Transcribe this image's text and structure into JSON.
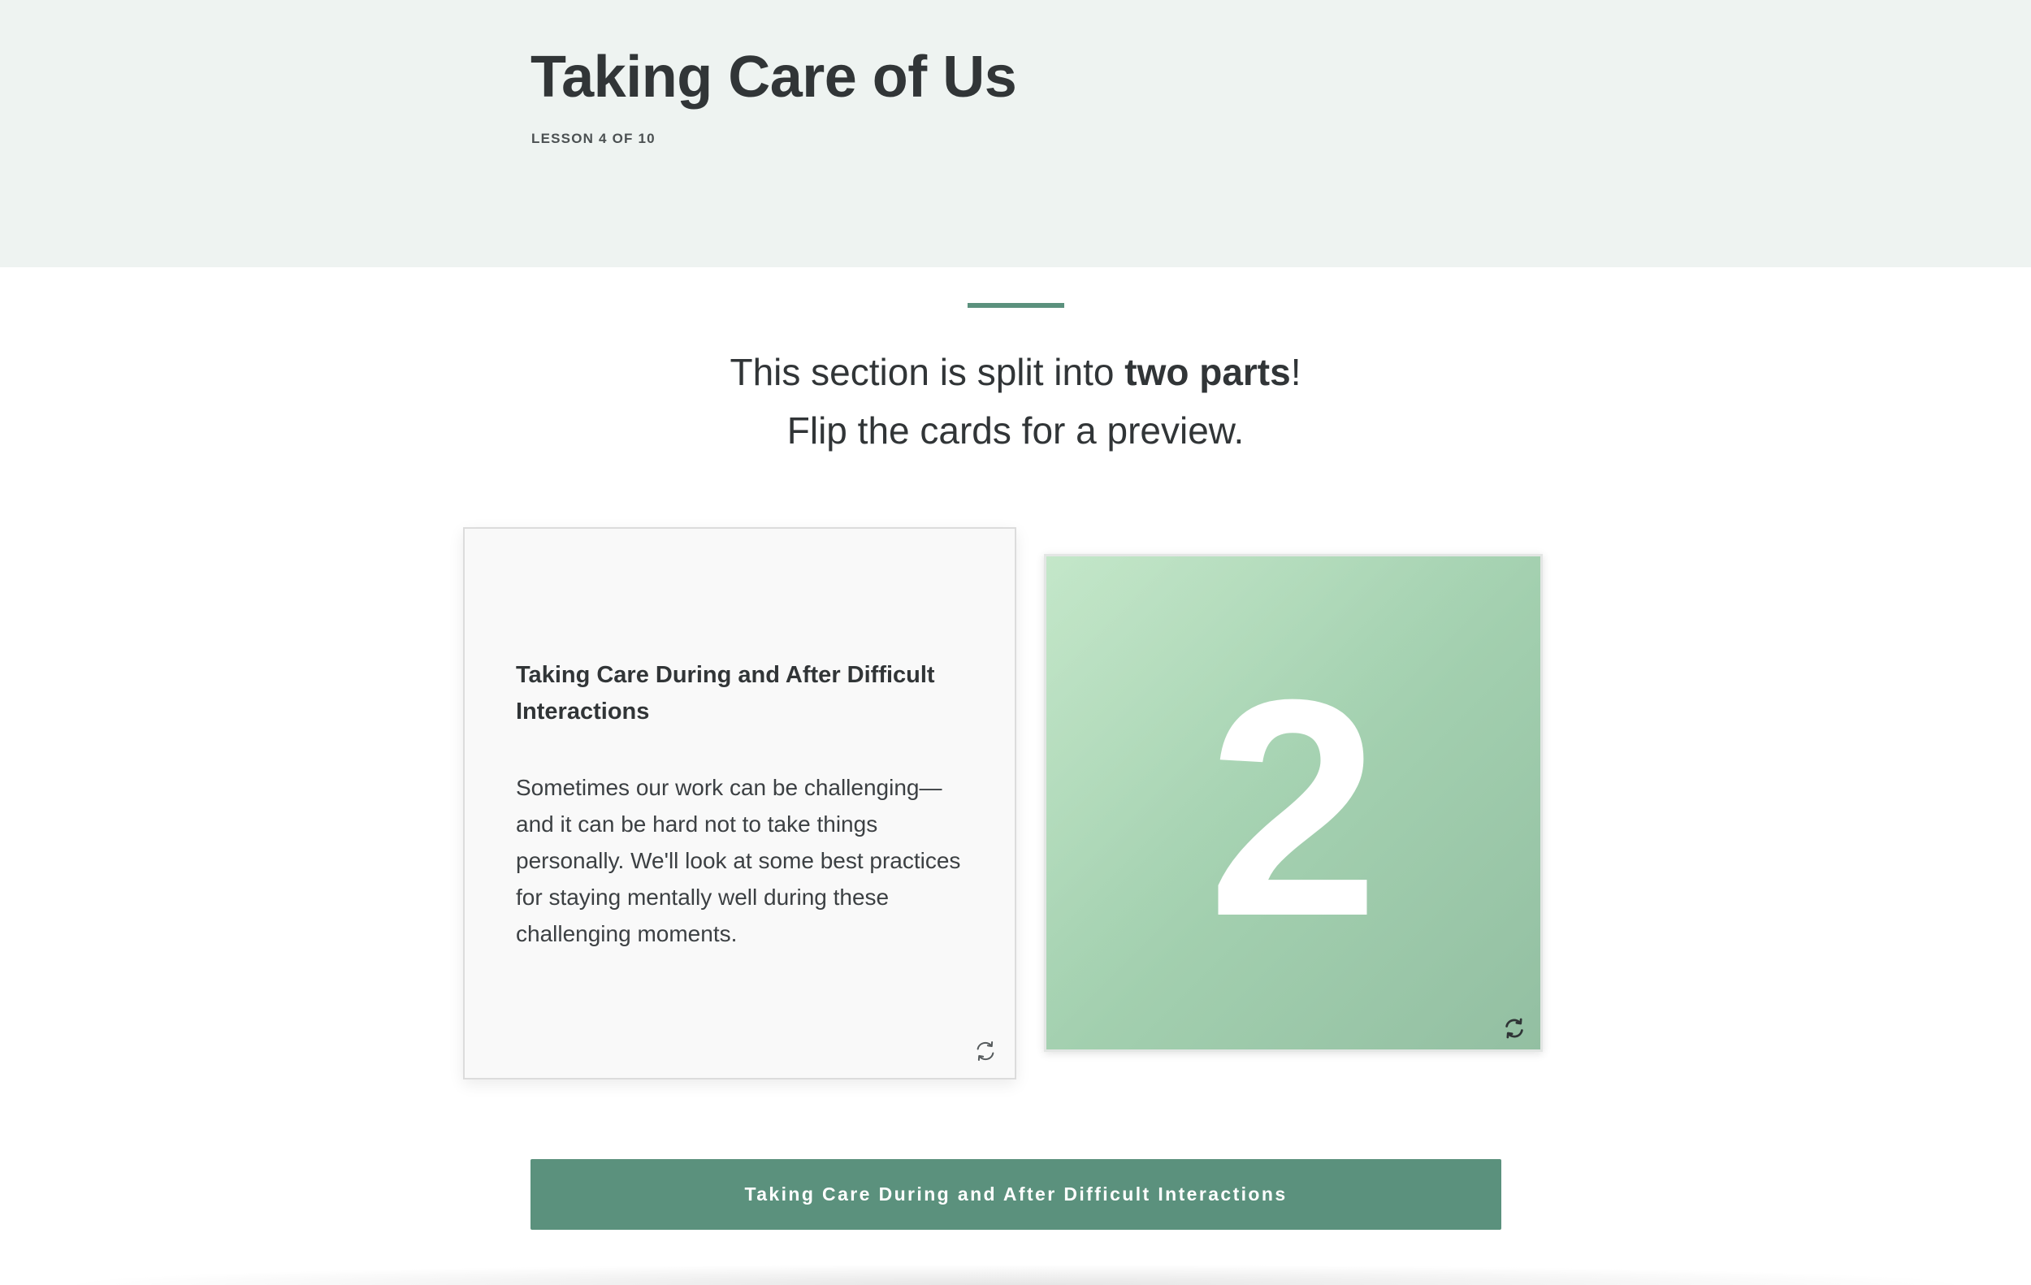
{
  "header": {
    "title": "Taking Care of Us",
    "lesson_progress": "LESSON 4 OF 10"
  },
  "intro": {
    "line1_prefix": "This section is split into ",
    "line1_bold": "two parts",
    "line1_suffix": "!",
    "line2": "Flip the cards for a preview."
  },
  "cards": [
    {
      "side": "back",
      "title": "Taking Care During and After Difficult Interactions",
      "body": "Sometimes our work can be challenging—and it can be hard not to take things personally. We'll look at some best practices for staying mentally well during these challenging moments.",
      "icon": "flip-icon"
    },
    {
      "side": "front",
      "number": "2",
      "icon": "flip-icon"
    }
  ],
  "cta": {
    "label": "Taking Care During and After Difficult Interactions"
  },
  "colors": {
    "header_bg": "#eef3f1",
    "accent": "#5b917d",
    "card_green": "#a5d2b1",
    "text": "#313537"
  }
}
